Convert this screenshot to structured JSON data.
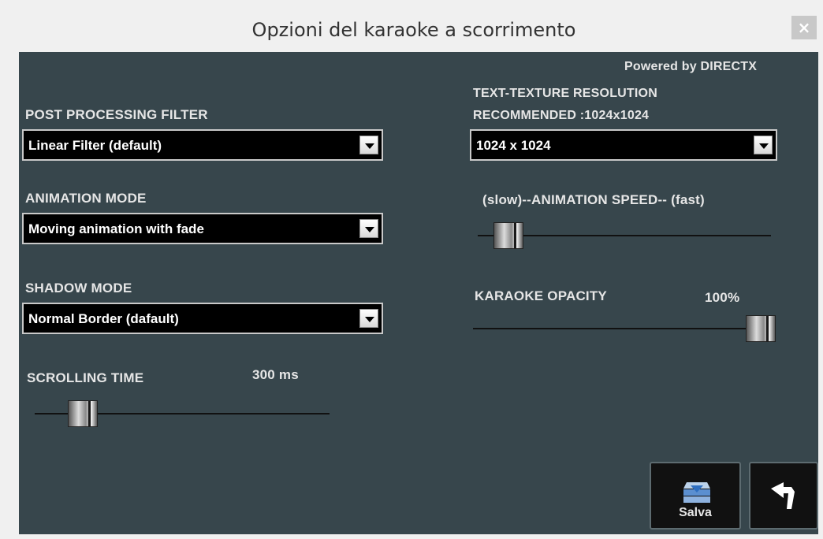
{
  "window": {
    "title": "Opzioni del karaoke a scorrimento",
    "close_glyph": "×"
  },
  "panel": {
    "powered_by": "Powered by DIRECTX",
    "post_processing": {
      "label": "POST PROCESSING FILTER",
      "value": "Linear Filter (default)"
    },
    "animation_mode": {
      "label": "ANIMATION MODE",
      "value": "Moving animation with fade"
    },
    "shadow_mode": {
      "label": "SHADOW MODE",
      "value": "Normal Border (dafault)"
    },
    "scrolling_time": {
      "label": "SCROLLING TIME",
      "value_text": "300 ms"
    },
    "text_texture": {
      "label_line1": "TEXT-TEXTURE RESOLUTION",
      "label_line2": "RECOMMENDED :1024x1024",
      "value": "1024 x 1024"
    },
    "animation_speed": {
      "label": "(slow)--ANIMATION SPEED-- (fast)"
    },
    "karaoke_opacity": {
      "label": "KARAOKE OPACITY",
      "value_text": "100%",
      "level_percent": 100
    }
  },
  "buttons": {
    "save_label": "Salva",
    "save_icon": "save-icon",
    "back_icon": "undo-arrow-icon"
  },
  "colors": {
    "panel_bg": "#37464c",
    "text": "#e6e6e6",
    "select_bg": "#000000"
  }
}
